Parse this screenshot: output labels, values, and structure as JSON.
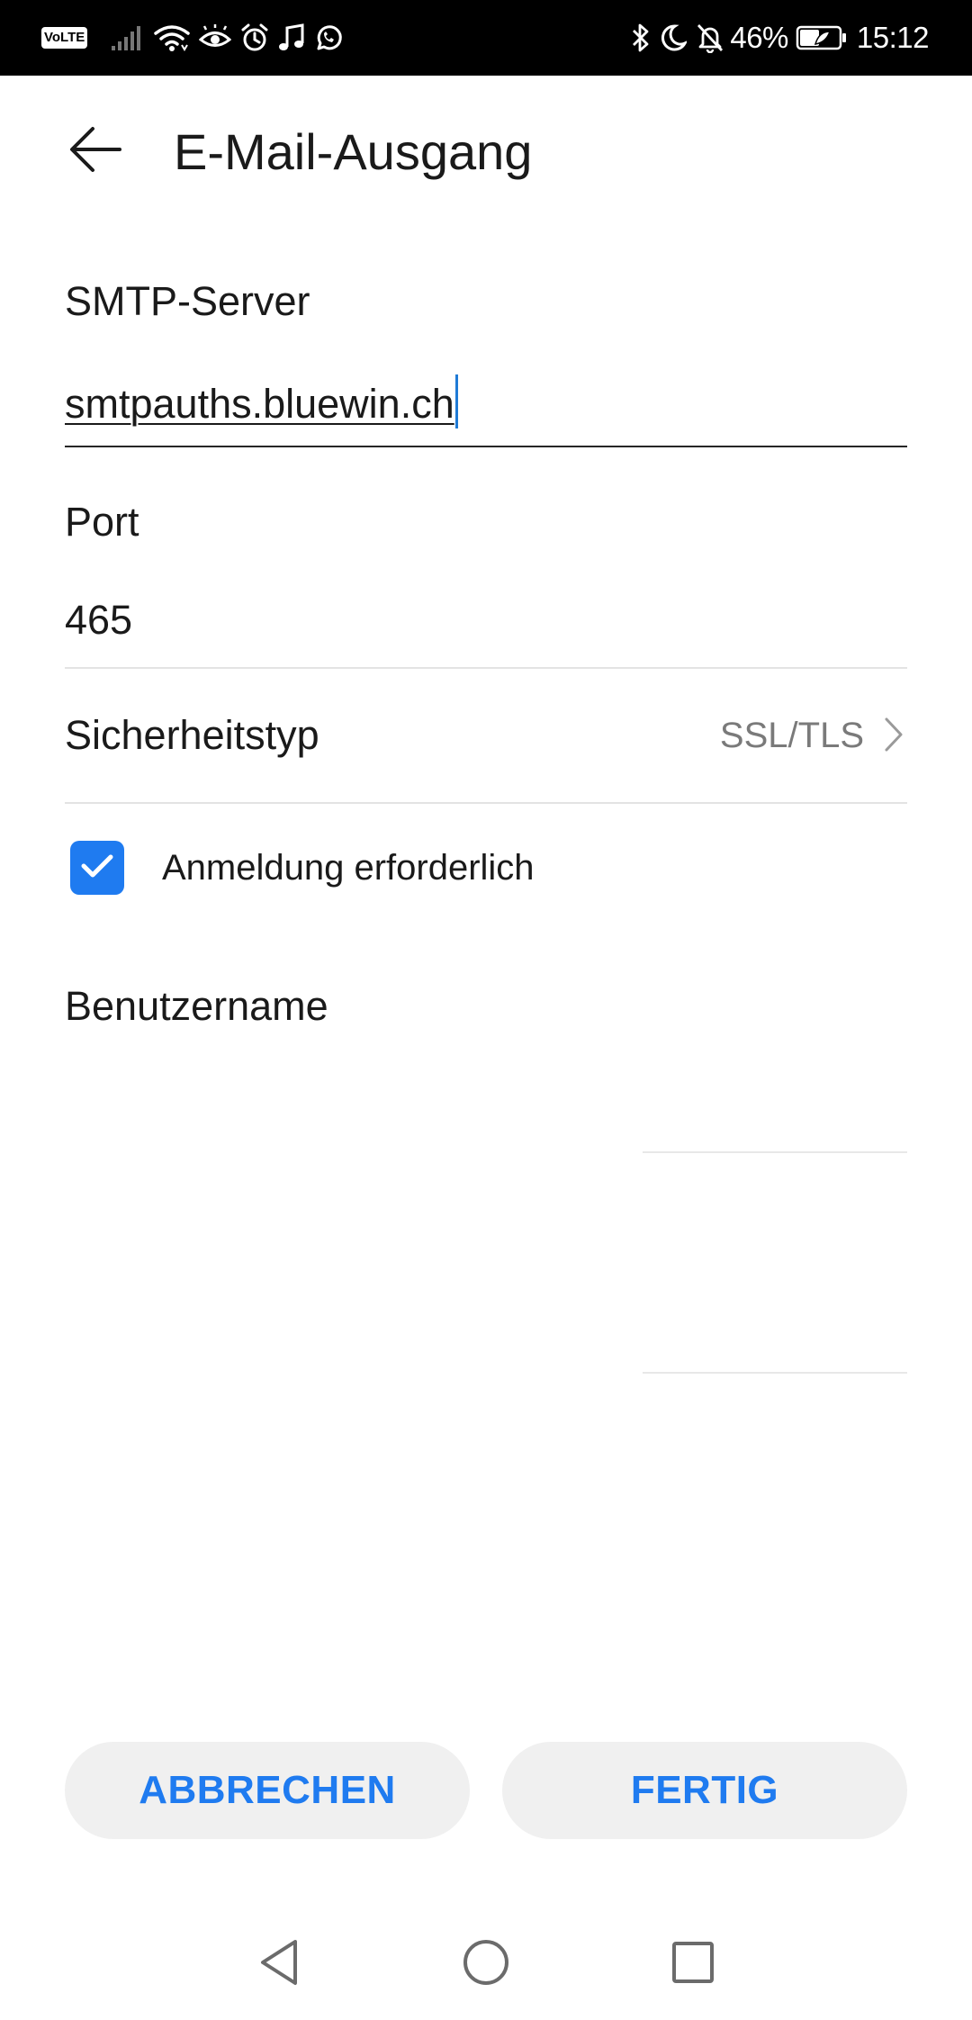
{
  "status_bar": {
    "volte": "VoLTE",
    "battery_percent": "46%",
    "time": "15:12",
    "icons": [
      "signal-icon",
      "wifi-icon",
      "eye-icon",
      "alarm-icon",
      "music-icon",
      "whatsapp-icon",
      "bluetooth-icon",
      "moon-icon",
      "bell-off-icon",
      "battery-icon"
    ]
  },
  "header": {
    "title": "E-Mail-Ausgang",
    "back_icon": "arrow-left-icon"
  },
  "form": {
    "smtp_label": "SMTP-Server",
    "smtp_value": "smtpauths.bluewin.ch",
    "port_label": "Port",
    "port_value": "465",
    "security_label": "Sicherheitstyp",
    "security_value": "SSL/TLS",
    "auth_checkbox_label": "Anmeldung erforderlich",
    "auth_checked": true,
    "username_label": "Benutzername"
  },
  "buttons": {
    "cancel_label": "ABBRECHEN",
    "done_label": "FERTIG"
  },
  "colors": {
    "accent": "#1f7bf0",
    "status_bar_bg": "#000000",
    "button_bg": "#f0f0f0",
    "secondary_text": "#7a7a7a"
  },
  "nav_bar": {
    "icons": [
      "nav-back-icon",
      "nav-home-icon",
      "nav-recent-icon"
    ]
  }
}
